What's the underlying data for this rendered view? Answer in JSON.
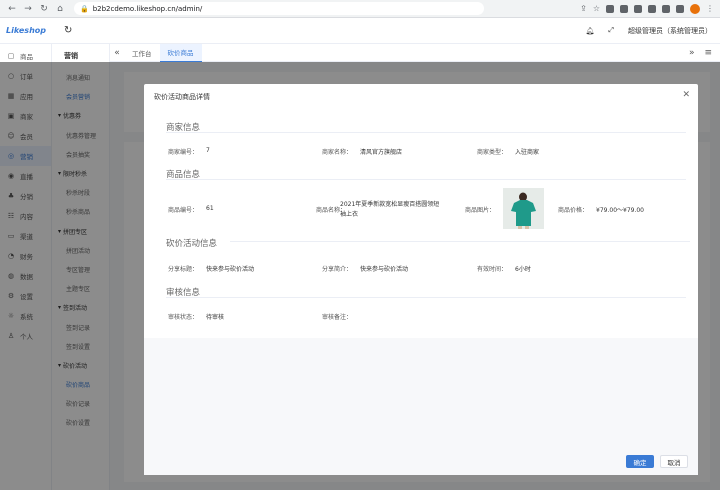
{
  "browser": {
    "url": "b2b2cdemo.likeshop.cn/admin/"
  },
  "header": {
    "logo": "Likeshop",
    "user": "超级管理员（系统管理员）"
  },
  "sidebar": {
    "items": [
      {
        "label": "商品",
        "icon": "bag-icon"
      },
      {
        "label": "订单",
        "icon": "order-icon"
      },
      {
        "label": "应用",
        "icon": "app-icon"
      },
      {
        "label": "商家",
        "icon": "shop-icon"
      },
      {
        "label": "会员",
        "icon": "member-icon"
      },
      {
        "label": "营销",
        "icon": "marketing-icon"
      },
      {
        "label": "直播",
        "icon": "live-icon"
      },
      {
        "label": "分销",
        "icon": "share-icon"
      },
      {
        "label": "内容",
        "icon": "content-icon"
      },
      {
        "label": "渠道",
        "icon": "channel-icon"
      },
      {
        "label": "财务",
        "icon": "finance-icon"
      },
      {
        "label": "数据",
        "icon": "data-icon"
      },
      {
        "label": "设置",
        "icon": "settings-icon"
      },
      {
        "label": "系统",
        "icon": "system-icon"
      },
      {
        "label": "个人",
        "icon": "person-icon"
      }
    ]
  },
  "submenu": {
    "title": "营销",
    "items": [
      {
        "label": "消息通知",
        "group": false
      },
      {
        "label": "会员营销",
        "group": false
      },
      {
        "label": "优惠券",
        "group": true
      },
      {
        "label": "优惠券管理",
        "group": false
      },
      {
        "label": "会员抽奖",
        "group": false
      },
      {
        "label": "限时秒杀",
        "group": true
      },
      {
        "label": "秒杀时段",
        "group": false
      },
      {
        "label": "秒杀商品",
        "group": false
      },
      {
        "label": "拼团专区",
        "group": true
      },
      {
        "label": "拼团活动",
        "group": false
      },
      {
        "label": "专区管理",
        "group": false
      },
      {
        "label": "主题专区",
        "group": false
      },
      {
        "label": "签到活动",
        "group": true
      },
      {
        "label": "签到记录",
        "group": false
      },
      {
        "label": "签到设置",
        "group": false
      },
      {
        "label": "砍价活动",
        "group": true
      },
      {
        "label": "砍价商品",
        "group": false
      },
      {
        "label": "砍价记录",
        "group": false
      },
      {
        "label": "砍价设置",
        "group": false
      }
    ]
  },
  "tabs": [
    {
      "label": "工作台"
    },
    {
      "label": "砍价商品"
    }
  ],
  "modal": {
    "title": "砍价活动商品详情",
    "sections": {
      "merchant": "商家信息",
      "product": "商品信息",
      "activity": "砍价活动信息",
      "audit": "审核信息"
    },
    "merchant": {
      "id_label": "商家编号：",
      "id_value": "7",
      "name_label": "商家名称：",
      "name_value": "清风官方旗舰店",
      "type_label": "商家类型：",
      "type_value": "入驻商家"
    },
    "product": {
      "code_label": "商品编号：",
      "code_value": "61",
      "name_label": "商品名称：",
      "name_value": "2021年夏季新款宽松显瘦百搭圆领短袖上衣",
      "image_label": "商品图片：",
      "price_label": "商品价格：",
      "price_value": "¥79.00～¥79.00"
    },
    "activity": {
      "share_title_label": "分享标题：",
      "share_title_value": "快来参与砍价活动",
      "share_desc_label": "分享简介：",
      "share_desc_value": "快来参与砍价活动",
      "duration_label": "有效时间：",
      "duration_value": "6小时"
    },
    "audit": {
      "status_label": "审核状态：",
      "status_value": "待审核",
      "note_label": "审核备注："
    },
    "ok_label": "确定",
    "cancel_label": "取消"
  }
}
